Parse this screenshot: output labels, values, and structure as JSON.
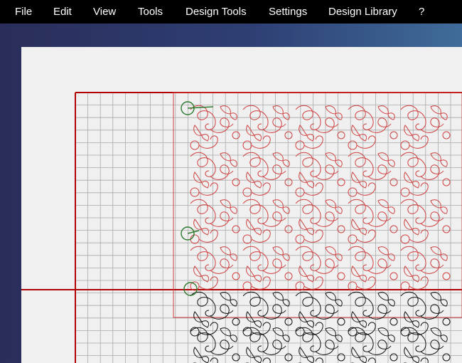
{
  "menu": {
    "items": [
      {
        "id": "file",
        "label": "File"
      },
      {
        "id": "edit",
        "label": "Edit"
      },
      {
        "id": "view",
        "label": "View"
      },
      {
        "id": "tools",
        "label": "Tools"
      },
      {
        "id": "design-tools",
        "label": "Design Tools"
      },
      {
        "id": "settings",
        "label": "Settings"
      },
      {
        "id": "design-library",
        "label": "Design Library"
      },
      {
        "id": "help",
        "label": "?"
      }
    ]
  },
  "colors": {
    "menubar": "#000000",
    "menu_text": "#ffffff",
    "canvas": "#f0f0f0",
    "grid": "#a9a9a9",
    "border_red": "#b00000",
    "selected_pattern": "#d04040",
    "stitched_pattern": "#111111",
    "start_marker": "#2f7a2f"
  },
  "icons": {
    "start_marker": "circle-start-icon"
  }
}
